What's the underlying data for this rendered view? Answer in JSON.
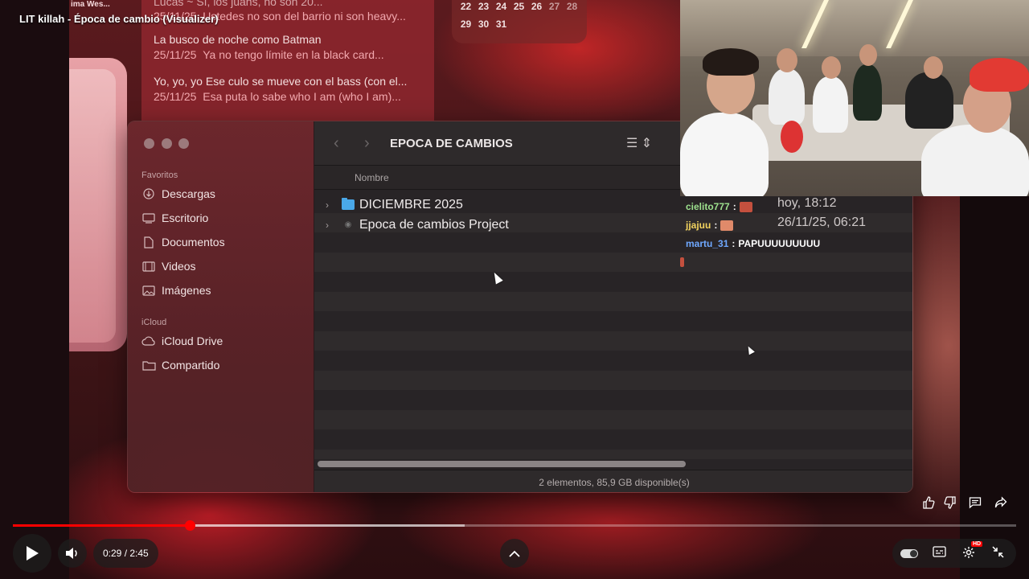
{
  "video": {
    "title": "LIT killah - Época de cambio (Visualizer)",
    "time": "0:29 / 2:45",
    "progress": 0.176,
    "buffered": 0.45,
    "hd_badge": "HD"
  },
  "background": {
    "top_left_fragment": "ima Wes...",
    "messages": [
      {
        "title": "Lucas ~ Sí, los juans, no son 20...",
        "date": "25/11/25",
        "preview": "Ustedes no son del barrio ni son heavy..."
      },
      {
        "title": "La busco de noche como Batman",
        "date": "25/11/25",
        "preview": "Ya no tengo límite en la black card..."
      },
      {
        "title": "Yo, yo, yo Ese culo se mueve con el bass (con el...",
        "date": "25/11/25",
        "preview": "Esa puta lo sabe who I am (who I am)..."
      }
    ],
    "calendar": {
      "row1": [
        "22",
        "23",
        "24",
        "25",
        "26",
        "27",
        "28"
      ],
      "row2": [
        "29",
        "30",
        "31"
      ]
    }
  },
  "finder": {
    "title": "EPOCA DE CAMBIOS",
    "sidebar": {
      "favorites_label": "Favoritos",
      "favorites": [
        {
          "label": "Descargas",
          "icon": "download-icon"
        },
        {
          "label": "Escritorio",
          "icon": "desktop-icon"
        },
        {
          "label": "Documentos",
          "icon": "document-icon"
        },
        {
          "label": "Videos",
          "icon": "film-icon"
        },
        {
          "label": "Imágenes",
          "icon": "image-icon"
        }
      ],
      "icloud_label": "iCloud",
      "icloud": [
        {
          "label": "iCloud Drive",
          "icon": "cloud-icon"
        },
        {
          "label": "Compartido",
          "icon": "shared-folder-icon"
        }
      ]
    },
    "column_name": "Nombre",
    "files": [
      {
        "name": "DICIEMBRE 2025",
        "icon": "folder-icon"
      },
      {
        "name": "Epoca de cambios Project",
        "icon": "project-file-icon"
      }
    ],
    "status": "2 elementos, 85,9 GB disponible(s)"
  },
  "stream": {
    "chat_times": [
      "hoy, 18:12",
      "26/11/25, 06:21"
    ],
    "chat": [
      {
        "user": "cielito777",
        "sep": ":",
        "message": "",
        "color": "#9ee28f"
      },
      {
        "user": "jjajuu",
        "sep": ":",
        "message": "",
        "color": "#f2d35f"
      },
      {
        "user": "martu_31",
        "sep": ":",
        "message": "PAPUUUUUUUUU",
        "color": "#6fa8ff"
      }
    ]
  },
  "colors": {
    "progress": "#ff0000",
    "folder": "#4aa8e8"
  }
}
